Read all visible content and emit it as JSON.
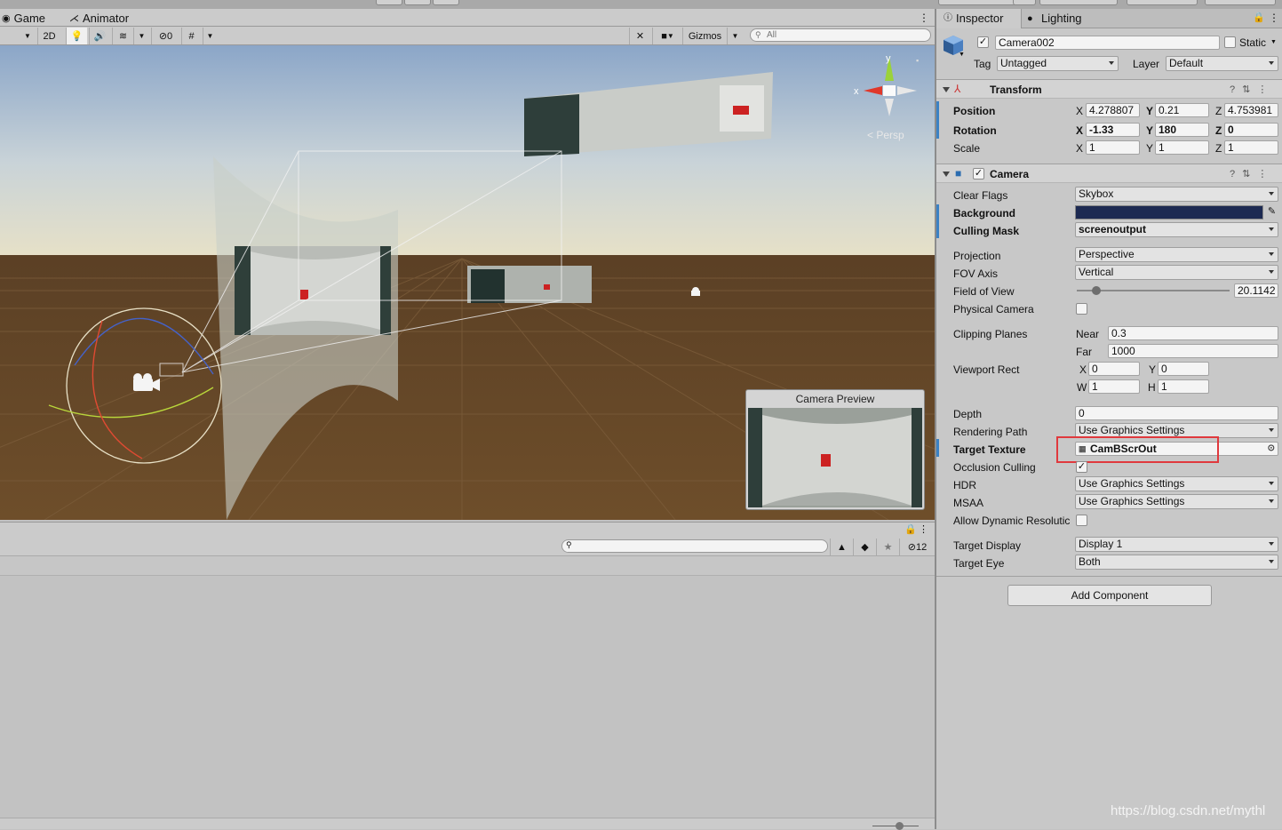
{
  "scene_panel": {
    "tabs": [
      {
        "label": "Game",
        "icon": "gamepad-icon"
      },
      {
        "label": "Animator",
        "icon": "animator-icon"
      }
    ],
    "toolbar": {
      "mode_2d": "2D",
      "hidden_count": "0",
      "gizmos_label": "Gizmos",
      "search_placeholder": "All"
    },
    "persp_label": "< Persp",
    "axis_labels": {
      "x": "x",
      "y": "y"
    },
    "camera_preview_title": "Camera Preview"
  },
  "project_panel": {
    "hidden_count": "12"
  },
  "inspector": {
    "tabs": [
      {
        "label": "Inspector",
        "icon": "info-icon"
      },
      {
        "label": "Lighting",
        "icon": "bulb-icon"
      }
    ],
    "object": {
      "name": "Camera002",
      "static_label": "Static",
      "tag_label": "Tag",
      "tag_value": "Untagged",
      "layer_label": "Layer",
      "layer_value": "Default"
    },
    "transform": {
      "title": "Transform",
      "position": {
        "label": "Position",
        "x": "4.278807",
        "y": "0.21",
        "z": "4.753981"
      },
      "rotation": {
        "label": "Rotation",
        "x": "-1.33",
        "y": "180",
        "z": "0"
      },
      "scale": {
        "label": "Scale",
        "x": "1",
        "y": "1",
        "z": "1"
      }
    },
    "camera": {
      "title": "Camera",
      "clear_flags": {
        "label": "Clear Flags",
        "value": "Skybox"
      },
      "background": {
        "label": "Background",
        "color": "#1d2a52"
      },
      "culling_mask": {
        "label": "Culling Mask",
        "value": "screenoutput"
      },
      "projection": {
        "label": "Projection",
        "value": "Perspective"
      },
      "fov_axis": {
        "label": "FOV Axis",
        "value": "Vertical"
      },
      "field_of_view": {
        "label": "Field of View",
        "value": "20.1142",
        "slider_fraction": 0.13
      },
      "physical_camera": {
        "label": "Physical Camera"
      },
      "clipping_planes": {
        "label": "Clipping Planes",
        "near_label": "Near",
        "near": "0.3",
        "far_label": "Far",
        "far": "1000"
      },
      "viewport_rect": {
        "label": "Viewport Rect",
        "x": "0",
        "y": "0",
        "w": "1",
        "h": "1"
      },
      "depth": {
        "label": "Depth",
        "value": "0"
      },
      "rendering_path": {
        "label": "Rendering Path",
        "value": "Use Graphics Settings"
      },
      "target_texture": {
        "label": "Target Texture",
        "value": "CamBScrOut"
      },
      "occlusion_culling": {
        "label": "Occlusion Culling"
      },
      "hdr": {
        "label": "HDR",
        "value": "Use Graphics Settings"
      },
      "msaa": {
        "label": "MSAA",
        "value": "Use Graphics Settings"
      },
      "allow_dynamic": {
        "label": "Allow Dynamic Resolutic"
      },
      "target_display": {
        "label": "Target Display",
        "value": "Display 1"
      },
      "target_eye": {
        "label": "Target Eye",
        "value": "Both"
      }
    },
    "add_component": "Add Component"
  },
  "watermark": "https://blog.csdn.net/mythl",
  "colors": {
    "highlight_box": "#e0393d",
    "accent": "#3b82c4"
  }
}
